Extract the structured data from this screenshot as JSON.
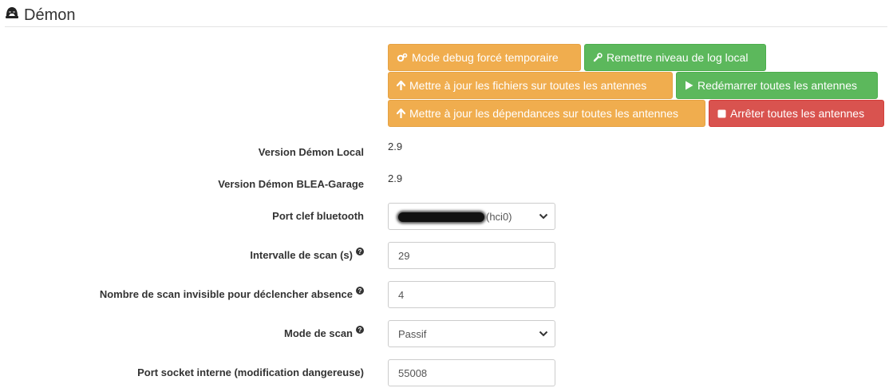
{
  "header": {
    "title": "Démon",
    "icon": "helmet-icon"
  },
  "actions": {
    "debug_mode": {
      "label": "Mode debug forcé temporaire",
      "icon": "cogs-icon",
      "color": "#f0ad4e"
    },
    "reset_log": {
      "label": "Remettre niveau de log local",
      "icon": "wrench-icon",
      "color": "#5cb85c"
    },
    "update_files": {
      "label": "Mettre à jour les fichiers sur toutes les antennes",
      "icon": "arrow-up-icon",
      "color": "#f0ad4e"
    },
    "restart_all": {
      "label": "Redémarrer toutes les antennes",
      "icon": "play-icon",
      "color": "#5cb85c"
    },
    "update_deps": {
      "label": "Mettre à jour les dépendances sur toutes les antennes",
      "icon": "arrow-up-icon",
      "color": "#f0ad4e"
    },
    "stop_all": {
      "label": "Arrêter toutes les antennes",
      "icon": "stop-icon",
      "color": "#d9534f"
    }
  },
  "form": {
    "version_local": {
      "label": "Version Démon Local",
      "value": "2.9"
    },
    "version_garage": {
      "label": "Version Démon BLEA-Garage",
      "value": "2.9"
    },
    "bt_port": {
      "label": "Port clef bluetooth",
      "value_suffix": "(hci0)"
    },
    "scan_interval": {
      "label": "Intervalle de scan (s)",
      "value": "29"
    },
    "absent_count": {
      "label": "Nombre de scan invisible pour déclencher absence",
      "value": "4"
    },
    "scan_mode": {
      "label": "Mode de scan",
      "value": "Passif"
    },
    "socket_port": {
      "label": "Port socket interne (modification dangereuse)",
      "value": "55008"
    }
  }
}
